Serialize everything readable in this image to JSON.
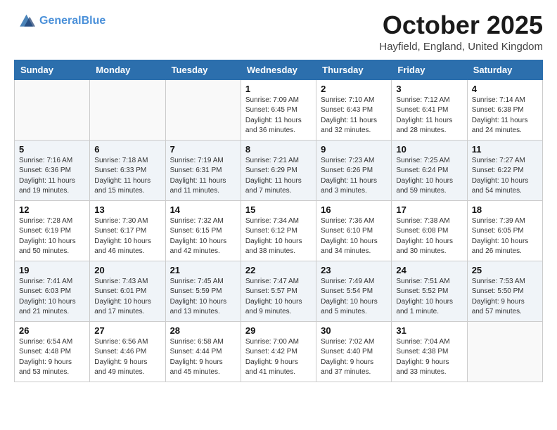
{
  "header": {
    "logo_line1": "General",
    "logo_line2": "Blue",
    "month_title": "October 2025",
    "location": "Hayfield, England, United Kingdom"
  },
  "days_of_week": [
    "Sunday",
    "Monday",
    "Tuesday",
    "Wednesday",
    "Thursday",
    "Friday",
    "Saturday"
  ],
  "weeks": [
    [
      {
        "day": "",
        "info": ""
      },
      {
        "day": "",
        "info": ""
      },
      {
        "day": "",
        "info": ""
      },
      {
        "day": "1",
        "info": "Sunrise: 7:09 AM\nSunset: 6:45 PM\nDaylight: 11 hours\nand 36 minutes."
      },
      {
        "day": "2",
        "info": "Sunrise: 7:10 AM\nSunset: 6:43 PM\nDaylight: 11 hours\nand 32 minutes."
      },
      {
        "day": "3",
        "info": "Sunrise: 7:12 AM\nSunset: 6:41 PM\nDaylight: 11 hours\nand 28 minutes."
      },
      {
        "day": "4",
        "info": "Sunrise: 7:14 AM\nSunset: 6:38 PM\nDaylight: 11 hours\nand 24 minutes."
      }
    ],
    [
      {
        "day": "5",
        "info": "Sunrise: 7:16 AM\nSunset: 6:36 PM\nDaylight: 11 hours\nand 19 minutes."
      },
      {
        "day": "6",
        "info": "Sunrise: 7:18 AM\nSunset: 6:33 PM\nDaylight: 11 hours\nand 15 minutes."
      },
      {
        "day": "7",
        "info": "Sunrise: 7:19 AM\nSunset: 6:31 PM\nDaylight: 11 hours\nand 11 minutes."
      },
      {
        "day": "8",
        "info": "Sunrise: 7:21 AM\nSunset: 6:29 PM\nDaylight: 11 hours\nand 7 minutes."
      },
      {
        "day": "9",
        "info": "Sunrise: 7:23 AM\nSunset: 6:26 PM\nDaylight: 11 hours\nand 3 minutes."
      },
      {
        "day": "10",
        "info": "Sunrise: 7:25 AM\nSunset: 6:24 PM\nDaylight: 10 hours\nand 59 minutes."
      },
      {
        "day": "11",
        "info": "Sunrise: 7:27 AM\nSunset: 6:22 PM\nDaylight: 10 hours\nand 54 minutes."
      }
    ],
    [
      {
        "day": "12",
        "info": "Sunrise: 7:28 AM\nSunset: 6:19 PM\nDaylight: 10 hours\nand 50 minutes."
      },
      {
        "day": "13",
        "info": "Sunrise: 7:30 AM\nSunset: 6:17 PM\nDaylight: 10 hours\nand 46 minutes."
      },
      {
        "day": "14",
        "info": "Sunrise: 7:32 AM\nSunset: 6:15 PM\nDaylight: 10 hours\nand 42 minutes."
      },
      {
        "day": "15",
        "info": "Sunrise: 7:34 AM\nSunset: 6:12 PM\nDaylight: 10 hours\nand 38 minutes."
      },
      {
        "day": "16",
        "info": "Sunrise: 7:36 AM\nSunset: 6:10 PM\nDaylight: 10 hours\nand 34 minutes."
      },
      {
        "day": "17",
        "info": "Sunrise: 7:38 AM\nSunset: 6:08 PM\nDaylight: 10 hours\nand 30 minutes."
      },
      {
        "day": "18",
        "info": "Sunrise: 7:39 AM\nSunset: 6:05 PM\nDaylight: 10 hours\nand 26 minutes."
      }
    ],
    [
      {
        "day": "19",
        "info": "Sunrise: 7:41 AM\nSunset: 6:03 PM\nDaylight: 10 hours\nand 21 minutes."
      },
      {
        "day": "20",
        "info": "Sunrise: 7:43 AM\nSunset: 6:01 PM\nDaylight: 10 hours\nand 17 minutes."
      },
      {
        "day": "21",
        "info": "Sunrise: 7:45 AM\nSunset: 5:59 PM\nDaylight: 10 hours\nand 13 minutes."
      },
      {
        "day": "22",
        "info": "Sunrise: 7:47 AM\nSunset: 5:57 PM\nDaylight: 10 hours\nand 9 minutes."
      },
      {
        "day": "23",
        "info": "Sunrise: 7:49 AM\nSunset: 5:54 PM\nDaylight: 10 hours\nand 5 minutes."
      },
      {
        "day": "24",
        "info": "Sunrise: 7:51 AM\nSunset: 5:52 PM\nDaylight: 10 hours\nand 1 minute."
      },
      {
        "day": "25",
        "info": "Sunrise: 7:53 AM\nSunset: 5:50 PM\nDaylight: 9 hours\nand 57 minutes."
      }
    ],
    [
      {
        "day": "26",
        "info": "Sunrise: 6:54 AM\nSunset: 4:48 PM\nDaylight: 9 hours\nand 53 minutes."
      },
      {
        "day": "27",
        "info": "Sunrise: 6:56 AM\nSunset: 4:46 PM\nDaylight: 9 hours\nand 49 minutes."
      },
      {
        "day": "28",
        "info": "Sunrise: 6:58 AM\nSunset: 4:44 PM\nDaylight: 9 hours\nand 45 minutes."
      },
      {
        "day": "29",
        "info": "Sunrise: 7:00 AM\nSunset: 4:42 PM\nDaylight: 9 hours\nand 41 minutes."
      },
      {
        "day": "30",
        "info": "Sunrise: 7:02 AM\nSunset: 4:40 PM\nDaylight: 9 hours\nand 37 minutes."
      },
      {
        "day": "31",
        "info": "Sunrise: 7:04 AM\nSunset: 4:38 PM\nDaylight: 9 hours\nand 33 minutes."
      },
      {
        "day": "",
        "info": ""
      }
    ]
  ]
}
